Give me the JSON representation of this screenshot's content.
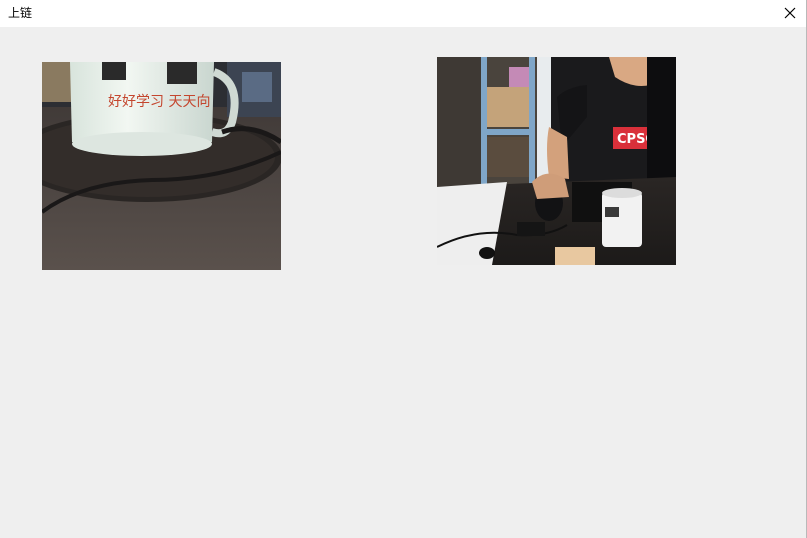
{
  "window": {
    "title": "上链",
    "close_icon": "close-icon"
  },
  "videos": {
    "left": {
      "mug_text": "好好学习  天天向"
    },
    "right": {
      "shirt_text": "CPSOL"
    }
  }
}
